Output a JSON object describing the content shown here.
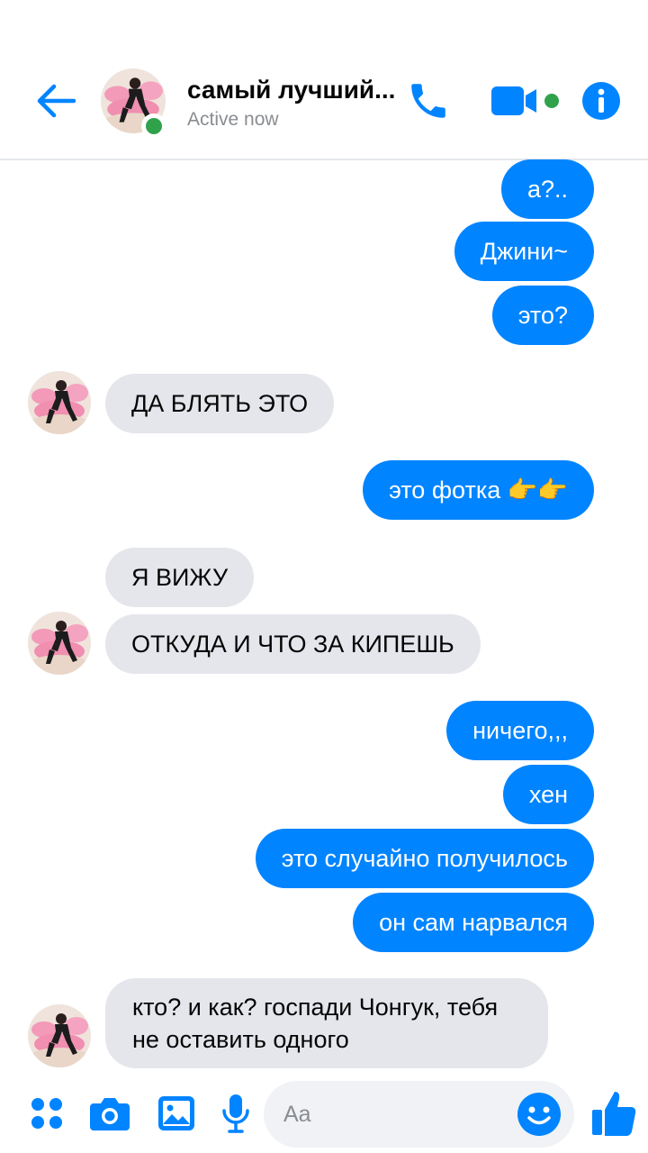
{
  "header": {
    "contact_name": "самый лучший...",
    "status": "Active now"
  },
  "messages": [
    {
      "side": "out",
      "text": "а?.."
    },
    {
      "side": "out",
      "text": "Джини~"
    },
    {
      "side": "out",
      "text": "это?"
    },
    {
      "side": "in",
      "text": "ДА БЛЯТЬ ЭТО"
    },
    {
      "side": "out",
      "text": "это фотка 👉👉"
    },
    {
      "side": "in",
      "text": "Я ВИЖУ"
    },
    {
      "side": "in",
      "text": "ОТКУДА И ЧТО ЗА КИПЕШЬ"
    },
    {
      "side": "out",
      "text": "ничего,,,"
    },
    {
      "side": "out",
      "text": "хен"
    },
    {
      "side": "out",
      "text": "это случайно получилось"
    },
    {
      "side": "out",
      "text": "он сам нарвался"
    },
    {
      "side": "in",
      "text": "кто? и как? госпади Чонгук, тебя не оставить одного"
    }
  ],
  "composer": {
    "placeholder": "Aa"
  },
  "colors": {
    "accent": "#0084ff",
    "incoming_bubble": "#e4e6eb",
    "online": "#31a24c"
  },
  "icons": [
    "back-arrow-icon",
    "phone-icon",
    "video-camera-icon",
    "info-icon",
    "apps-grid-icon",
    "camera-icon",
    "image-icon",
    "microphone-icon",
    "emoji-icon",
    "thumbs-up-icon"
  ]
}
